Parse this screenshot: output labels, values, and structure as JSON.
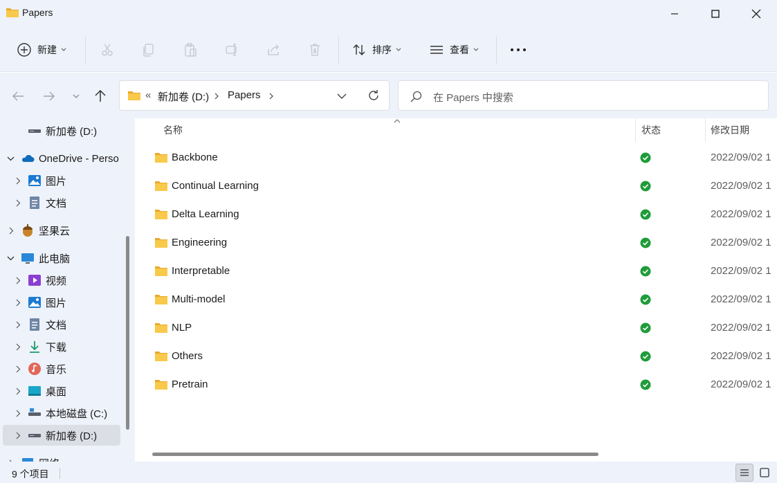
{
  "window": {
    "title": "Papers",
    "minimize_icon": "minimize-icon",
    "maximize_icon": "maximize-icon",
    "close_icon": "close-icon"
  },
  "toolbar": {
    "new_label": "新建",
    "sort_label": "排序",
    "view_label": "查看",
    "more_label": "···",
    "disabled_icons": [
      "cut-icon",
      "copy-icon",
      "paste-icon",
      "rename-icon",
      "share-icon",
      "delete-icon"
    ]
  },
  "address": {
    "overflow": "«",
    "crumbs": [
      "新加卷 (D:)",
      "Papers"
    ]
  },
  "search": {
    "placeholder": "在 Papers 中搜索"
  },
  "sidebar": {
    "items": [
      {
        "label": "新加卷 (D:)",
        "icon": "drive-icon"
      },
      {
        "label": "OneDrive - Perso",
        "icon": "onedrive-icon"
      },
      {
        "label": "图片",
        "icon": "pictures-icon"
      },
      {
        "label": "文档",
        "icon": "documents-icon"
      },
      {
        "label": "坚果云",
        "icon": "nutstore-icon"
      },
      {
        "label": "此电脑",
        "icon": "this-pc-icon"
      },
      {
        "label": "视频",
        "icon": "videos-icon"
      },
      {
        "label": "图片",
        "icon": "pictures-icon"
      },
      {
        "label": "文档",
        "icon": "documents-icon"
      },
      {
        "label": "下载",
        "icon": "downloads-icon"
      },
      {
        "label": "音乐",
        "icon": "music-icon"
      },
      {
        "label": "桌面",
        "icon": "desktop-icon"
      },
      {
        "label": "本地磁盘 (C:)",
        "icon": "drive-icon"
      },
      {
        "label": "新加卷 (D:)",
        "icon": "drive-icon"
      },
      {
        "label": "网络",
        "icon": "network-icon"
      }
    ]
  },
  "columns": {
    "name": "名称",
    "status": "状态",
    "modified": "修改日期"
  },
  "files": [
    {
      "name": "Backbone",
      "status": "synced",
      "date": "2022/09/02 1"
    },
    {
      "name": "Continual Learning",
      "status": "synced",
      "date": "2022/09/02 1"
    },
    {
      "name": "Delta Learning",
      "status": "synced",
      "date": "2022/09/02 1"
    },
    {
      "name": "Engineering",
      "status": "synced",
      "date": "2022/09/02 1"
    },
    {
      "name": "Interpretable",
      "status": "synced",
      "date": "2022/09/02 1"
    },
    {
      "name": "Multi-model",
      "status": "synced",
      "date": "2022/09/02 1"
    },
    {
      "name": "NLP",
      "status": "synced",
      "date": "2022/09/02 1"
    },
    {
      "name": "Others",
      "status": "synced",
      "date": "2022/09/02 1"
    },
    {
      "name": "Pretrain",
      "status": "synced",
      "date": "2022/09/02 1"
    }
  ],
  "statusbar": {
    "count": "9 个项目"
  },
  "colors": {
    "chrome": "#eef2fa",
    "folder": "#f8c94a",
    "synced": "#1f9c3a",
    "accent": "#0067c0"
  }
}
